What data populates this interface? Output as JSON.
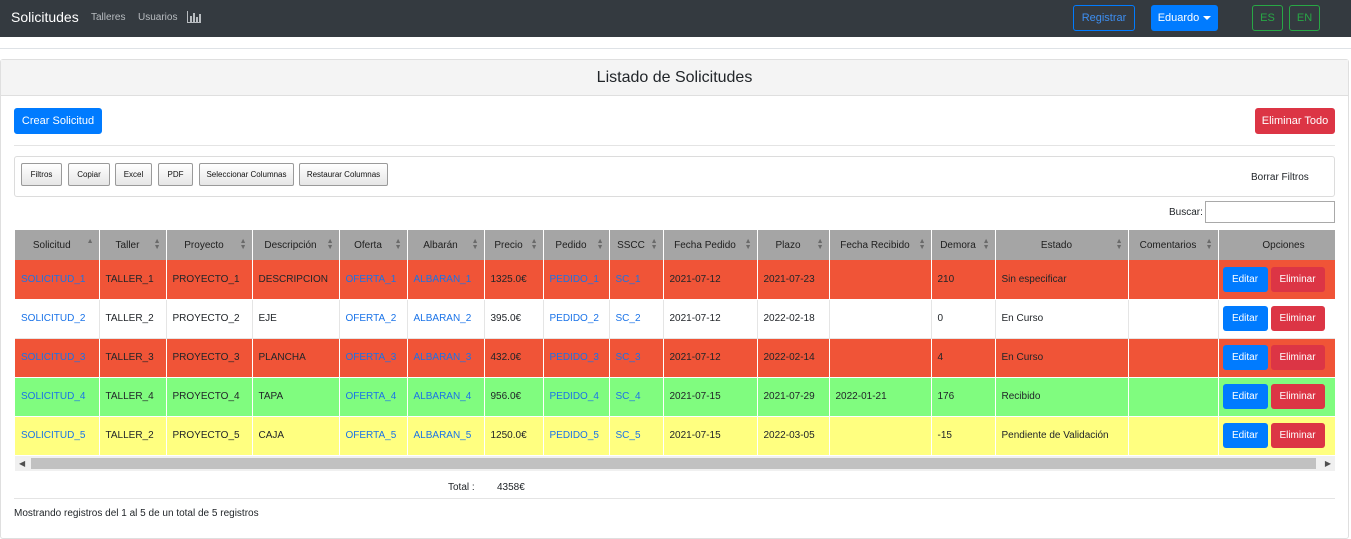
{
  "navbar": {
    "brand": "Solicitudes",
    "links": [
      "Talleres",
      "Usuarios"
    ],
    "chart_icon": "bar-chart-icon",
    "register_label": "Registrar",
    "user_label": "Eduardo",
    "lang_es": "ES",
    "lang_en": "EN",
    "colors": {
      "bg": "#343a40",
      "primary": "#007bff",
      "success": "#28a745"
    }
  },
  "card": {
    "title": "Listado de Solicitudes",
    "create_label": "Crear Solicitud",
    "delete_all_label": "Eliminar Todo"
  },
  "toolbar": {
    "buttons": [
      "Filtros",
      "Copiar",
      "Excel",
      "PDF",
      "Seleccionar Columnas",
      "Restaurar Columnas"
    ],
    "clear_filters": "Borrar Filtros",
    "search_label": "Buscar:",
    "search_value": ""
  },
  "table": {
    "columns": [
      "Solicitud",
      "Taller",
      "Proyecto",
      "Descripción",
      "Oferta",
      "Albarán",
      "Precio",
      "Pedido",
      "SSCC",
      "Fecha Pedido",
      "Plazo",
      "Fecha Recibido",
      "Demora",
      "Estado",
      "Comentarios",
      "Opciones"
    ],
    "row_colors": {
      "red": "#f05437",
      "white": "#ffffff",
      "green": "#80fc7f",
      "yellow": "#ffff80"
    },
    "rows": [
      {
        "color": "red",
        "cells": [
          "SOLICITUD_1",
          "TALLER_1",
          "PROYECTO_1",
          "DESCRIPCION",
          "OFERTA_1",
          "ALBARAN_1",
          "1325.0€",
          "PEDIDO_1",
          "SC_1",
          "2021-07-12",
          "2021-07-23",
          "",
          "210",
          "Sin especificar",
          ""
        ]
      },
      {
        "color": "white",
        "cells": [
          "SOLICITUD_2",
          "TALLER_2",
          "PROYECTO_2",
          "EJE",
          "OFERTA_2",
          "ALBARAN_2",
          "395.0€",
          "PEDIDO_2",
          "SC_2",
          "2021-07-12",
          "2022-02-18",
          "",
          "0",
          "En Curso",
          ""
        ]
      },
      {
        "color": "red",
        "cells": [
          "SOLICITUD_3",
          "TALLER_3",
          "PROYECTO_3",
          "PLANCHA",
          "OFERTA_3",
          "ALBARAN_3",
          "432.0€",
          "PEDIDO_3",
          "SC_3",
          "2021-07-12",
          "2022-02-14",
          "",
          "4",
          "En Curso",
          ""
        ]
      },
      {
        "color": "green",
        "cells": [
          "SOLICITUD_4",
          "TALLER_4",
          "PROYECTO_4",
          "TAPA",
          "OFERTA_4",
          "ALBARAN_4",
          "956.0€",
          "PEDIDO_4",
          "SC_4",
          "2021-07-15",
          "2021-07-29",
          "2022-01-21",
          "176",
          "Recibido",
          ""
        ]
      },
      {
        "color": "yellow",
        "cells": [
          "SOLICITUD_5",
          "TALLER_2",
          "PROYECTO_5",
          "CAJA",
          "OFERTA_5",
          "ALBARAN_5",
          "1250.0€",
          "PEDIDO_5",
          "SC_5",
          "2021-07-15",
          "2022-03-05",
          "",
          "-15",
          "Pendiente de Validación",
          ""
        ]
      }
    ],
    "edit_label": "Editar",
    "delete_label": "Eliminar"
  },
  "footer": {
    "total_label": "Total :",
    "total_value": "4358€",
    "info": "Mostrando registros del 1 al 5 de un total de 5 registros"
  }
}
